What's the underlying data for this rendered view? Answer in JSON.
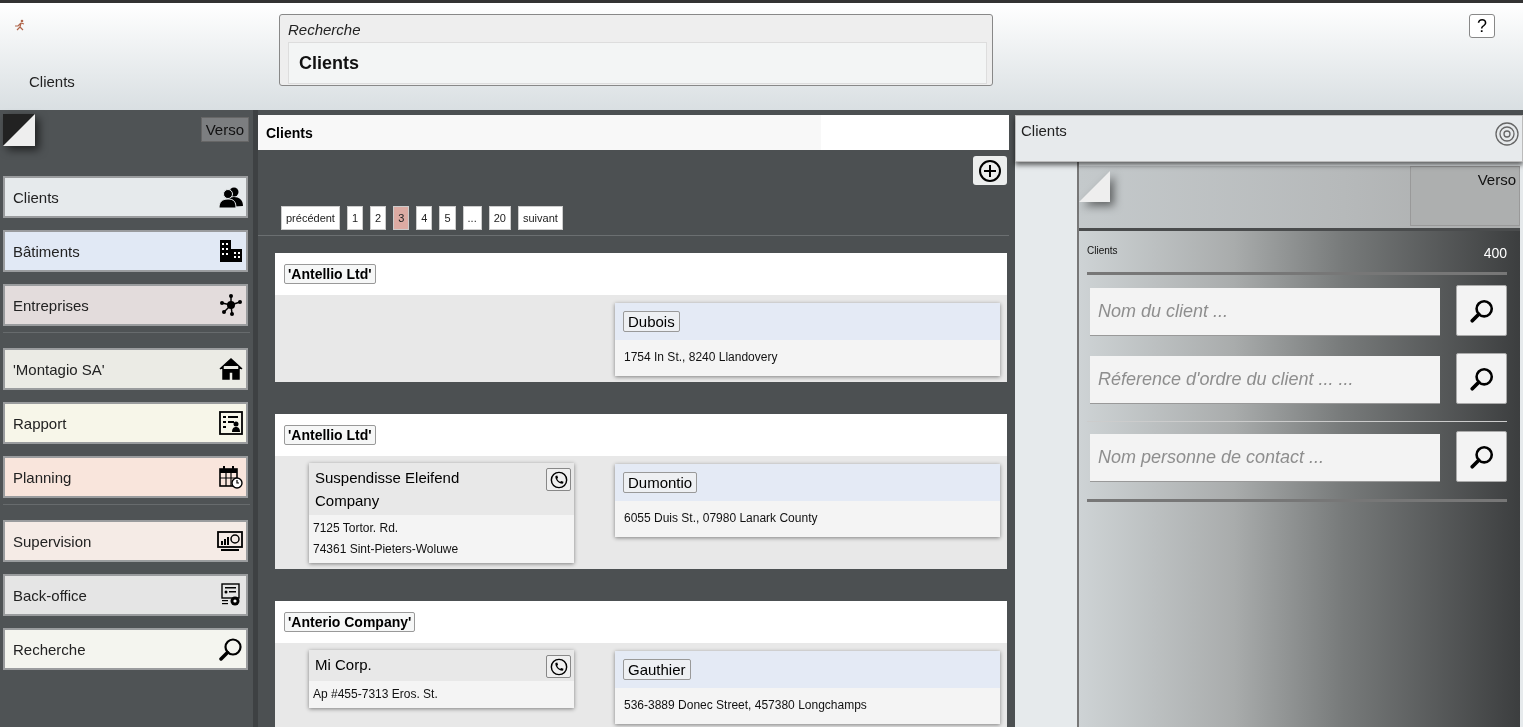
{
  "header": {
    "app_label": "Clients",
    "search": {
      "label": "Recherche",
      "value": "Clients"
    },
    "help_button": "?"
  },
  "sidebar": {
    "verso_button": "Verso",
    "groups": [
      {
        "items": [
          {
            "label": "Clients",
            "color": "#e6eaec"
          },
          {
            "label": "Bâtiments",
            "color": "#e1e9f5"
          },
          {
            "label": "Entreprises",
            "color": "#e3dcdc"
          }
        ]
      },
      {
        "items": [
          {
            "label": "'Montagio SA'",
            "color": "#ebebe5"
          },
          {
            "label": "Rapport",
            "color": "#f7f6e9"
          },
          {
            "label": "Planning",
            "color": "#f9e5dc"
          }
        ]
      },
      {
        "items": [
          {
            "label": "Supervision",
            "color": "#f5ebe6"
          },
          {
            "label": "Back-office",
            "color": "#e5e5e5"
          },
          {
            "label": "Recherche",
            "color": "#f4f5ef"
          }
        ]
      }
    ]
  },
  "center": {
    "title": "Clients",
    "pagination": {
      "previous": "précédent",
      "pages": [
        {
          "label": "1",
          "selected": false
        },
        {
          "label": "2",
          "selected": false
        },
        {
          "label": "3",
          "selected": true
        },
        {
          "label": "4",
          "selected": false
        },
        {
          "label": "5",
          "selected": false
        },
        {
          "label": "...",
          "selected": false
        },
        {
          "label": "20",
          "selected": false
        }
      ],
      "next": "suivant"
    },
    "groups": [
      {
        "name": "'Antellio Ltd'",
        "contact": {
          "name": "Dubois",
          "address": "1754 In St., 8240 Llandovery"
        }
      },
      {
        "name": "'Antellio Ltd'",
        "company": {
          "name": "Suspendisse Eleifend Company",
          "address_lines": [
            "7125 Tortor. Rd.",
            "74361 Sint-Pieters-Woluwe"
          ]
        },
        "contact": {
          "name": "Dumontio",
          "address": "6055 Duis St., 07980 Lanark County"
        }
      },
      {
        "name": "'Anterio Company'",
        "company": {
          "name": "Mi Corp.",
          "address_lines": [
            "Ap #455-7313 Eros. St."
          ]
        },
        "contact": {
          "name": "Gauthier",
          "address": "536-3889 Donec Street, 457380 Longchamps"
        }
      }
    ]
  },
  "right_panel": {
    "title": "Clients",
    "verso_button": "Verso",
    "list_label": "Clients",
    "count": "400",
    "search_groups": [
      {
        "fields": [
          {
            "placeholder": "Nom du client ..."
          },
          {
            "placeholder": "Réference d'ordre du client ... ..."
          }
        ]
      },
      {
        "fields": [
          {
            "placeholder": "Nom personne de contact ..."
          }
        ]
      }
    ]
  }
}
